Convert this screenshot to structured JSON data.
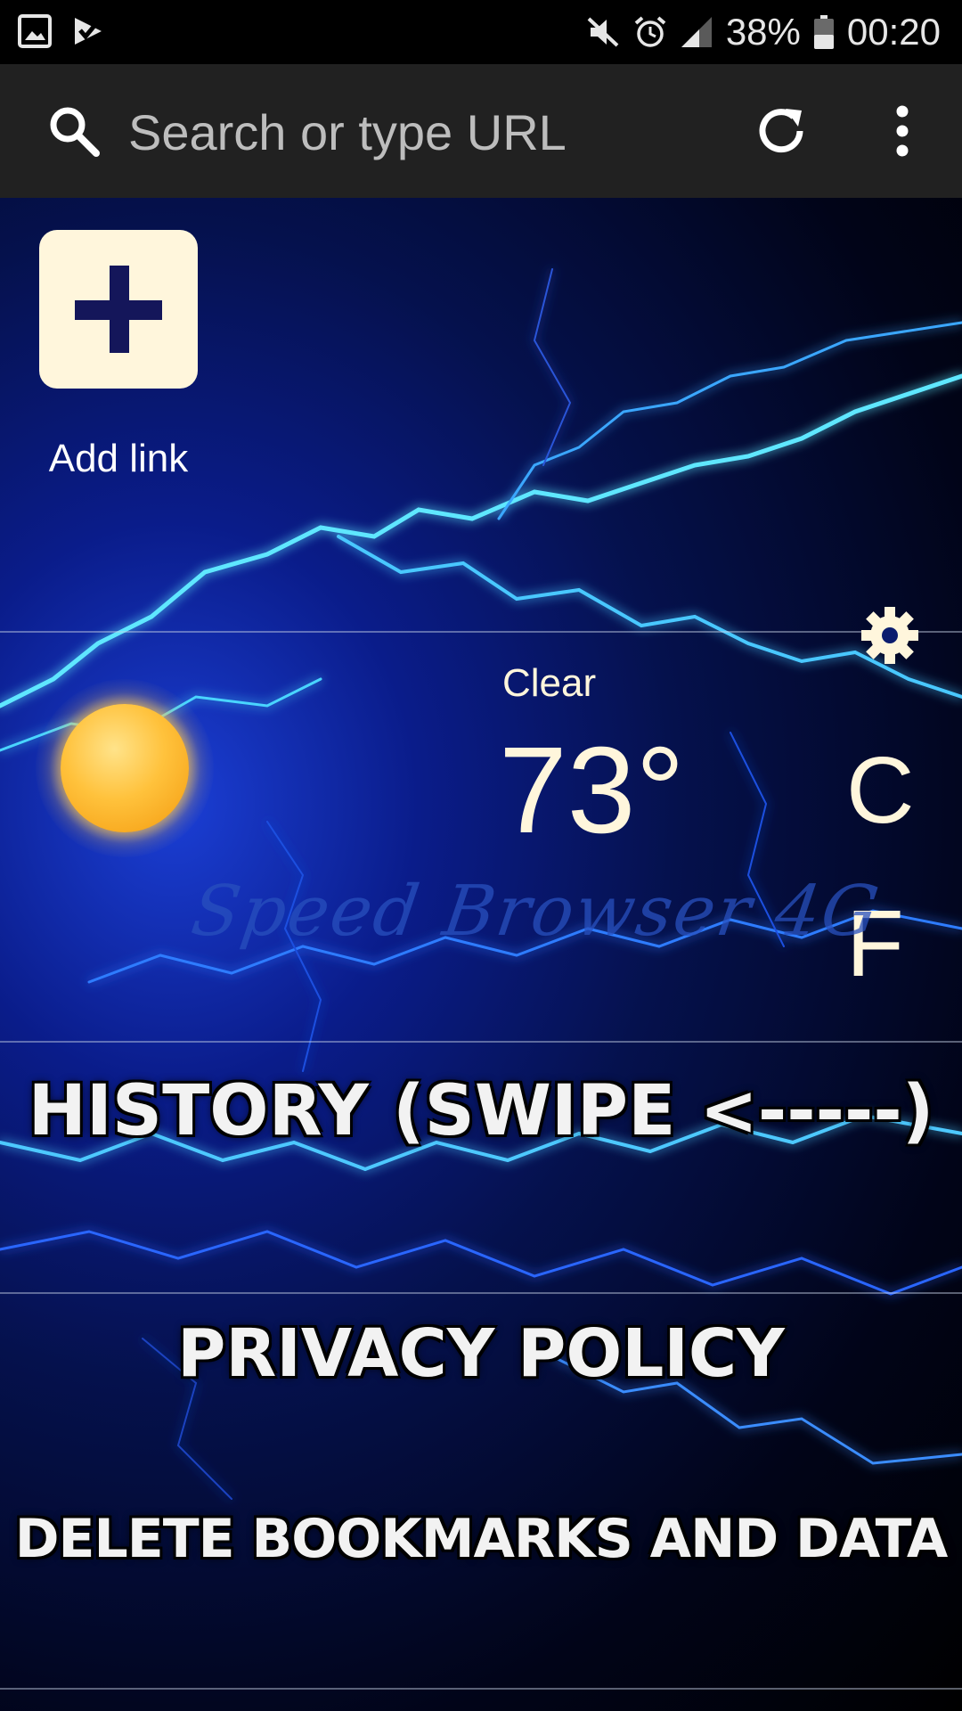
{
  "status_bar": {
    "battery_percent": "38%",
    "time": "00:20"
  },
  "toolbar": {
    "search_placeholder": "Search or type URL"
  },
  "speed_dial": {
    "add_link_label": "Add link"
  },
  "weather": {
    "condition": "Clear",
    "temperature": "73°",
    "unit_c": "C",
    "unit_f": "F"
  },
  "watermark": "Speed Browser 4G",
  "menu": {
    "history_label": "HISTORY  (SWIPE <-----)",
    "privacy_label": "PRIVACY POLICY",
    "delete_label": "DELETE BOOKMARKS AND DATA"
  },
  "colors": {
    "toolbar_bg": "#212121",
    "tile_bg": "#fff6dc",
    "plus_color": "#14165a",
    "weather_text": "#fff6dc"
  }
}
